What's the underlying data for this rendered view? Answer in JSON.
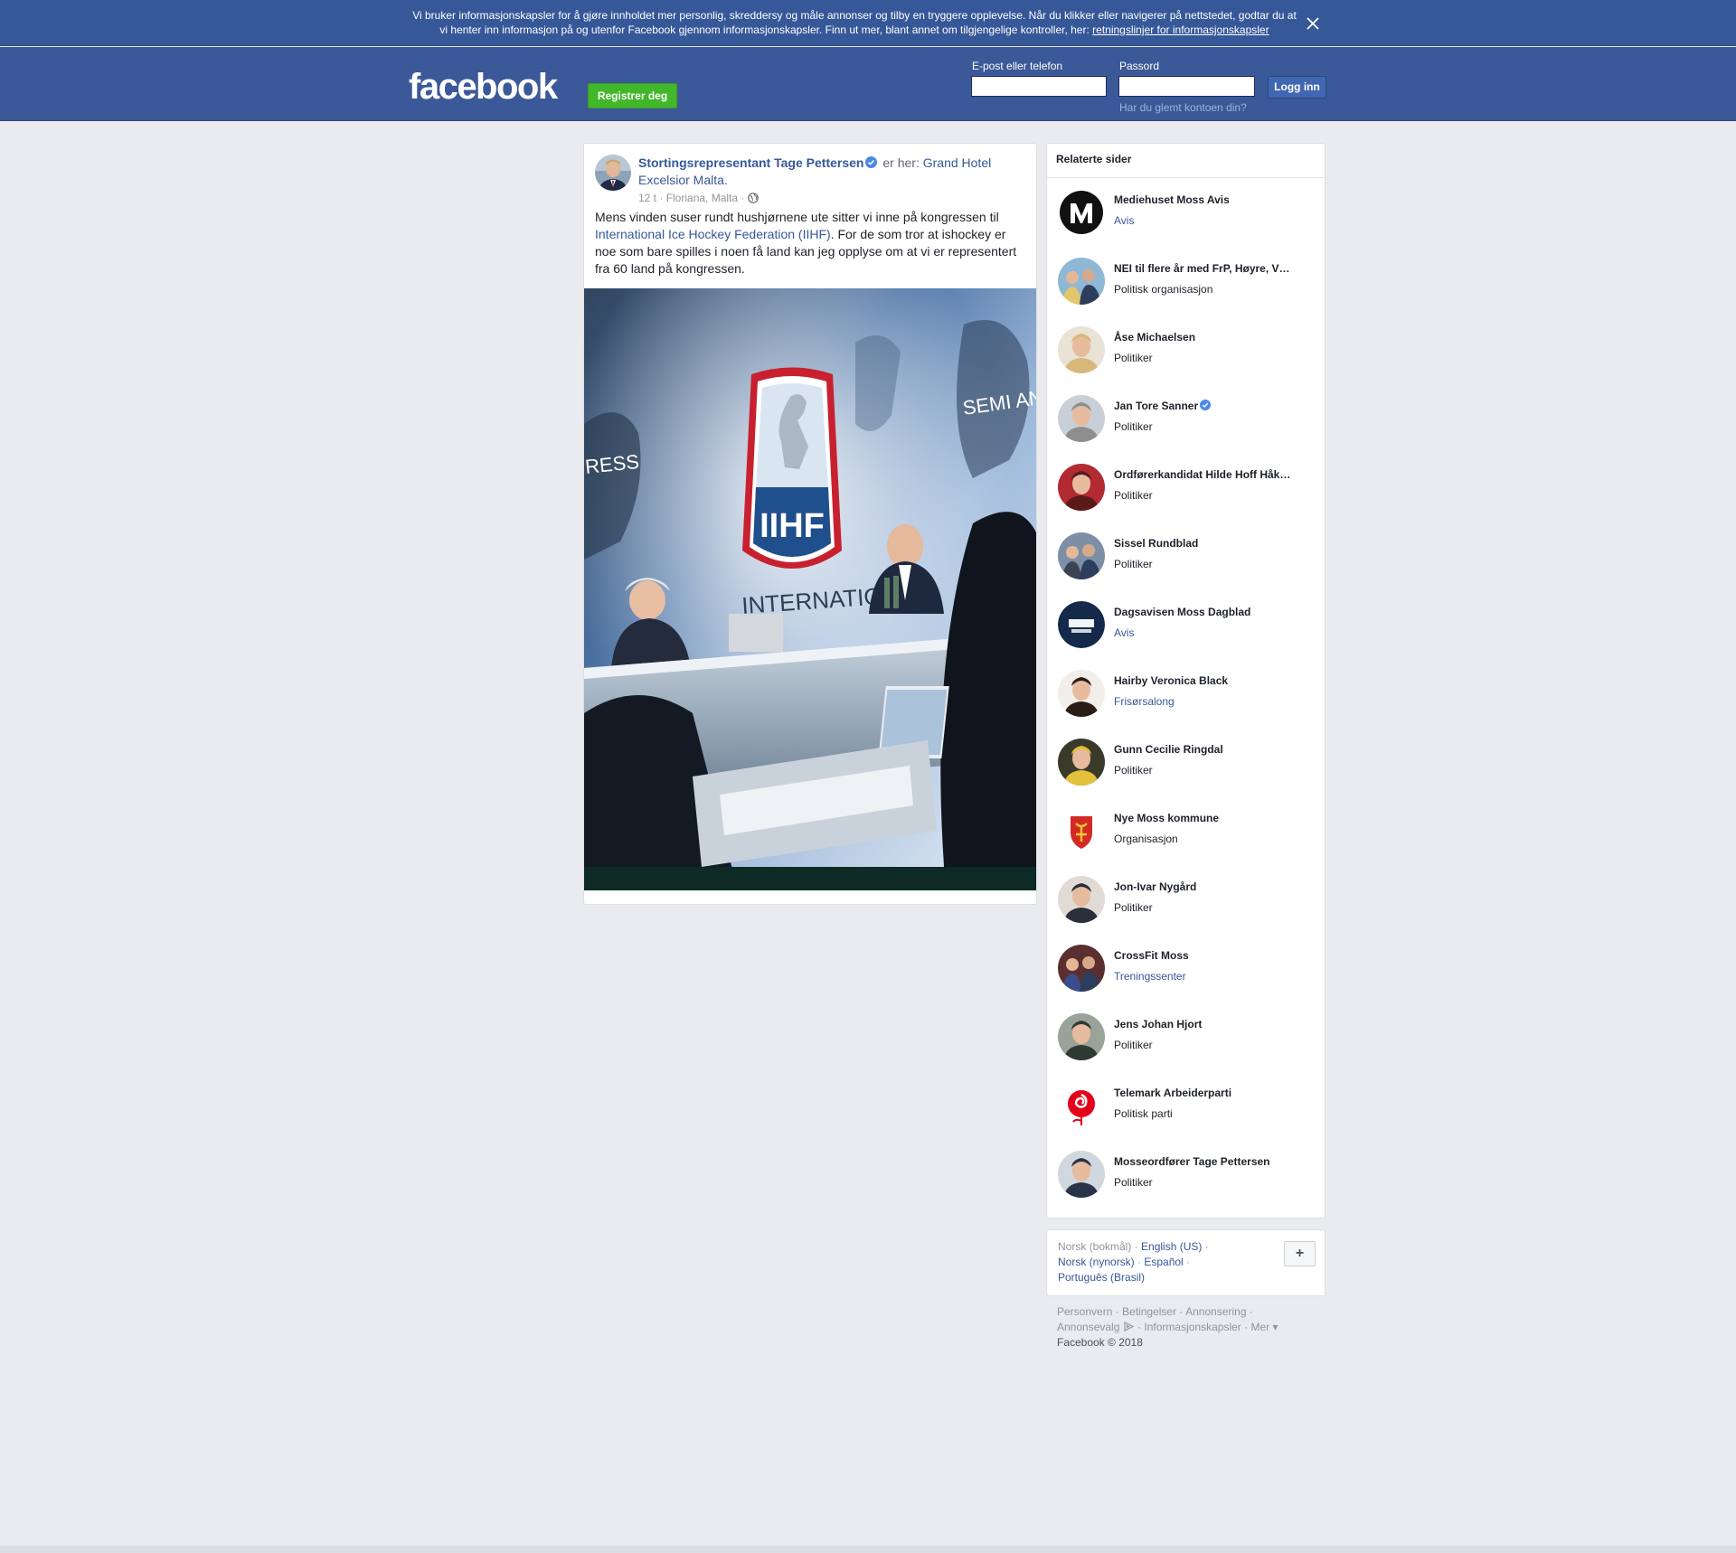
{
  "cookie_banner": {
    "text": "Vi bruker informasjonskapsler for å gjøre innholdet mer personlig, skreddersy og måle annonser og tilby en tryggere opplevelse. Når du klikker eller navigerer på nettstedet, godtar du at vi henter inn informasjon på og utenfor Facebook gjennom informasjonskapsler. Finn ut mer, blant annet om tilgjengelige kontroller, her: ",
    "link_label": "retningslinjer for informasjonskapsler"
  },
  "header": {
    "logo": "facebook",
    "register_label": "Registrer deg",
    "email_label": "E-post eller telefon",
    "password_label": "Passord",
    "login_label": "Logg inn",
    "forgot_label": "Har du glemt kontoen din?"
  },
  "post": {
    "author": "Stortingsrepresentant Tage Pettersen",
    "checkin_text": " er her: ",
    "place": "Grand Hotel Excelsior Malta.",
    "time": "12 t",
    "location": "Floriana, Malta",
    "body_before": "Mens vinden suser rundt hushjørnene ute sitter vi inne på kongressen til ",
    "body_mention": "International Ice Hockey Federation (IIHF)",
    "body_after": ". For de som tror at ishockey er noe som bare spilles i noen få land kan jeg opplyse om at vi er representert fra 60 land på kongressen.",
    "photo_texts": {
      "logo": "IIHF",
      "left_wall": "RESS",
      "right_wall": "SEMI AN",
      "banner": "INTERNATIO"
    }
  },
  "related": {
    "title": "Relaterte sider",
    "items": [
      {
        "name": "Mediehuset Moss Avis",
        "category": "Avis",
        "category_link": true,
        "verified": false,
        "avatar": "moss-avis-logo"
      },
      {
        "name": "NEI til flere år med FrP, Høyre, V…",
        "category": "Politisk organisasjon",
        "category_link": false,
        "verified": false,
        "avatar": "cartoon"
      },
      {
        "name": "Åse Michaelsen",
        "category": "Politiker",
        "category_link": false,
        "verified": false,
        "avatar": "person"
      },
      {
        "name": "Jan Tore Sanner",
        "category": "Politiker",
        "category_link": false,
        "verified": true,
        "avatar": "person"
      },
      {
        "name": "Ordførerkandidat Hilde Hoff Håk…",
        "category": "Politiker",
        "category_link": false,
        "verified": false,
        "avatar": "person"
      },
      {
        "name": "Sissel Rundblad",
        "category": "Politiker",
        "category_link": false,
        "verified": false,
        "avatar": "group"
      },
      {
        "name": "Dagsavisen Moss Dagblad",
        "category": "Avis",
        "category_link": true,
        "verified": false,
        "avatar": "moss-dagblad-logo"
      },
      {
        "name": "Hairby Veronica Black",
        "category": "Frisørsalong",
        "category_link": true,
        "verified": false,
        "avatar": "person"
      },
      {
        "name": "Gunn Cecilie Ringdal",
        "category": "Politiker",
        "category_link": false,
        "verified": false,
        "avatar": "person"
      },
      {
        "name": "Nye Moss kommune",
        "category": "Organisasjon",
        "category_link": false,
        "verified": false,
        "avatar": "coat-of-arms"
      },
      {
        "name": "Jon-Ivar Nygård",
        "category": "Politiker",
        "category_link": false,
        "verified": false,
        "avatar": "person"
      },
      {
        "name": "CrossFit Moss",
        "category": "Treningssenter",
        "category_link": true,
        "verified": false,
        "avatar": "group"
      },
      {
        "name": "Jens Johan Hjort",
        "category": "Politiker",
        "category_link": false,
        "verified": false,
        "avatar": "person"
      },
      {
        "name": "Telemark Arbeiderparti",
        "category": "Politisk parti",
        "category_link": false,
        "verified": false,
        "avatar": "rose-logo"
      },
      {
        "name": "Mosseordfører Tage Pettersen",
        "category": "Politiker",
        "category_link": false,
        "verified": false,
        "avatar": "person"
      }
    ]
  },
  "languages": {
    "current": "Norsk (bokmål)",
    "options": [
      "English (US)",
      "Norsk (nynorsk)",
      "Español",
      "Português (Brasil)"
    ],
    "more_label": "+"
  },
  "footer": {
    "links": [
      "Personvern",
      "Betingelser",
      "Annonsering",
      "Annonsevalg",
      "Informasjonskapsler",
      "Mer"
    ],
    "copyright": "Facebook © 2018"
  },
  "colors": {
    "brand_blue": "#3b5998",
    "banner_blue": "#365899",
    "register_green": "#42b72a",
    "link_blue": "#365899",
    "page_bg": "#e9ebee"
  }
}
